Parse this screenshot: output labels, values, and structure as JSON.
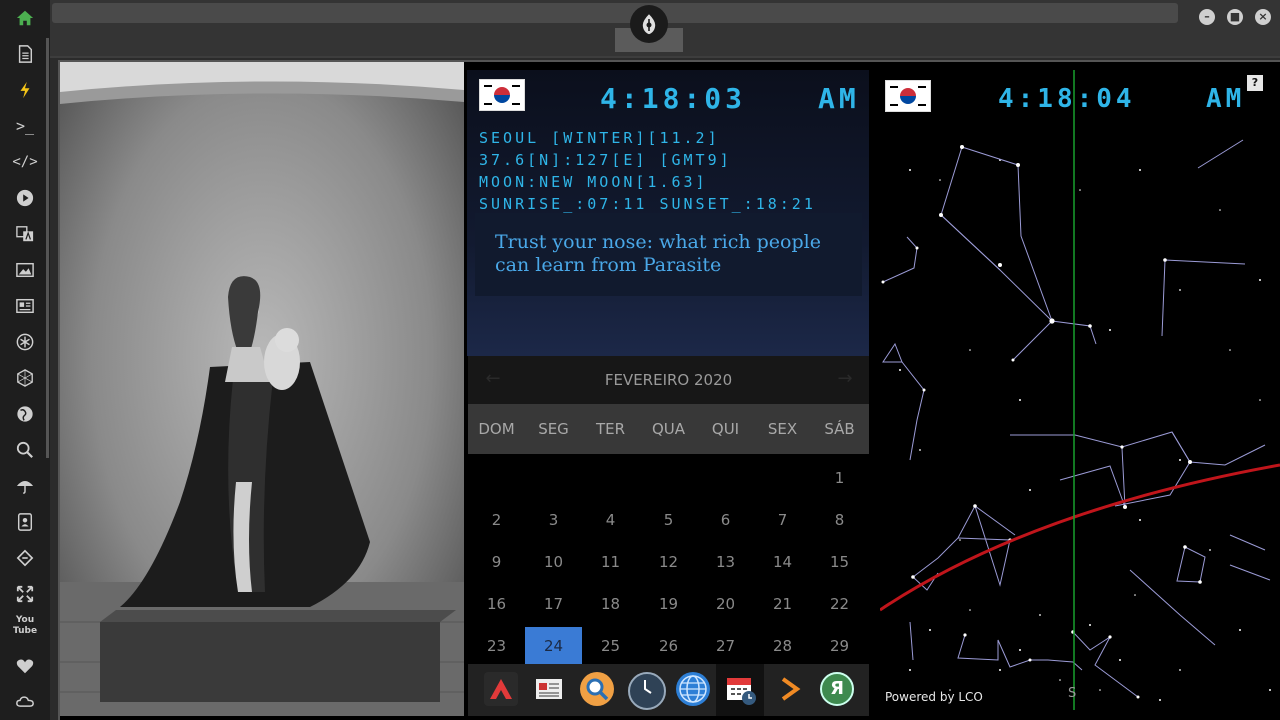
{
  "topbar": {
    "window_controls": [
      "minimize-icon",
      "maximize-icon",
      "close-icon"
    ]
  },
  "left_rail": {
    "icons": [
      "home-icon",
      "document-icon",
      "bolt-icon",
      "terminal-icon",
      "code-icon",
      "play-icon",
      "translate-icon",
      "image-icon",
      "news-icon",
      "asterisk-icon",
      "hexagon-icon",
      "globe-icon",
      "search-icon",
      "umbrella-icon",
      "contacts-icon",
      "link-icon",
      "expand-icon",
      "youtube-icon",
      "heart-icon",
      "cloud-icon"
    ],
    "youtube_label": "You Tube"
  },
  "clock_panel": {
    "time": "4:18:03",
    "ampm": "AM",
    "line1": "SEOUL [WINTER][11.2]",
    "line2": "37.6[N]:127[E] [GMT9]",
    "line3": "MOON:NEW MOON[1.63]",
    "line4": "SUNRISE_:07:11 SUNSET_:18:21",
    "headline": "Trust your nose: what rich people can learn from Parasite",
    "accent": "#2fb5e8"
  },
  "calendar": {
    "month_label": "FEVEREIRO 2020",
    "prev": "←",
    "next": "→",
    "weekdays": [
      "DOM",
      "SEG",
      "TER",
      "QUA",
      "QUI",
      "SEX",
      "SÁB"
    ],
    "weeks": [
      [
        "",
        "",
        "",
        "",
        "",
        "",
        "1"
      ],
      [
        "2",
        "3",
        "4",
        "5",
        "6",
        "7",
        "8"
      ],
      [
        "9",
        "10",
        "11",
        "12",
        "13",
        "14",
        "15"
      ],
      [
        "16",
        "17",
        "18",
        "19",
        "20",
        "21",
        "22"
      ],
      [
        "23",
        "24",
        "25",
        "26",
        "27",
        "28",
        "29"
      ]
    ],
    "selected": "24",
    "selected_color": "#3a7bd5"
  },
  "dock": {
    "apps": [
      "arrow-app-icon",
      "news-app-icon",
      "search-app-icon",
      "clock-app-icon",
      "globe-app-icon",
      "calendar-app-icon",
      "play-arrow-app-icon",
      "yandex-app-icon"
    ],
    "yandex_letter": "Я"
  },
  "sky_panel": {
    "time": "4:18:04",
    "ampm": "AM",
    "help": "?",
    "powered_by": "Powered by LCO",
    "compass_south": "S"
  }
}
